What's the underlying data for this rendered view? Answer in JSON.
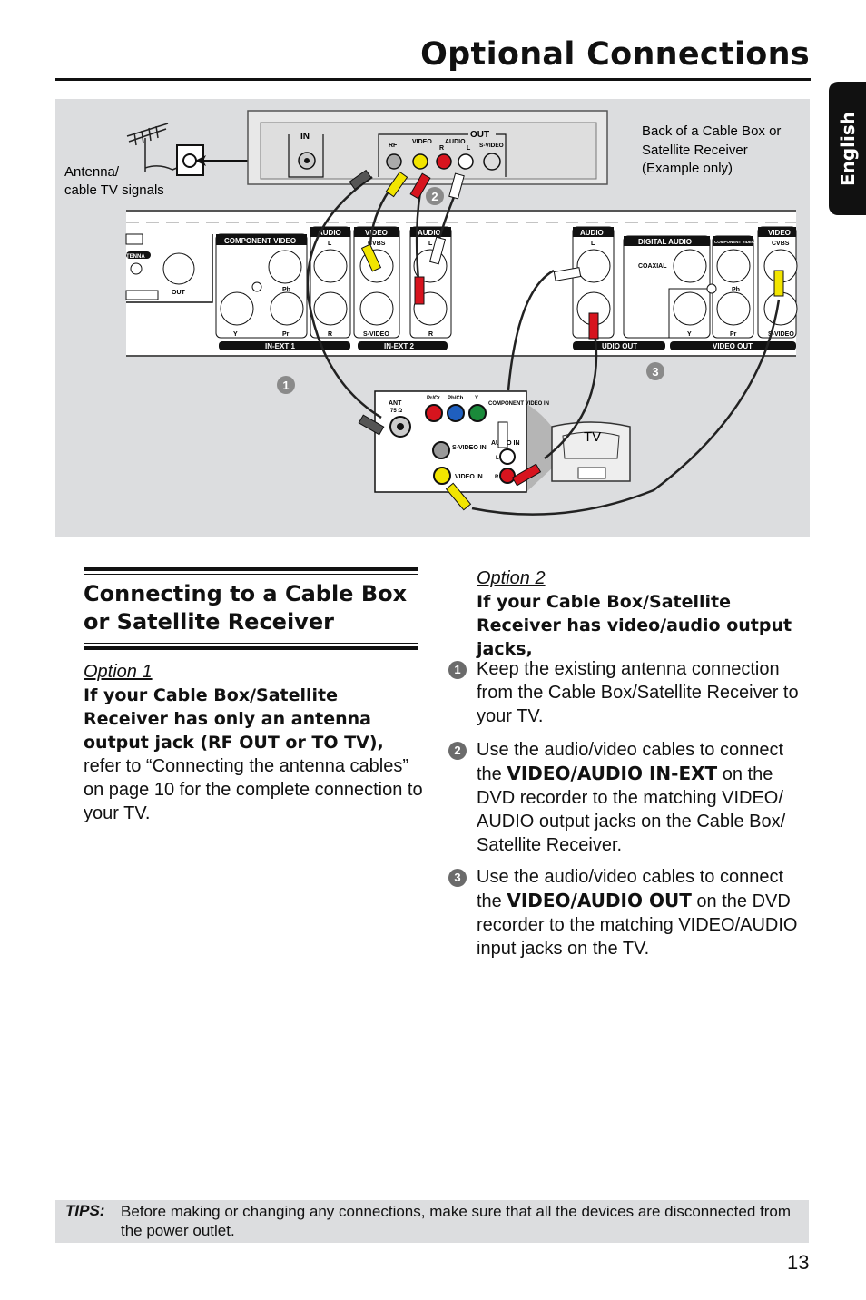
{
  "header": {
    "title": "Optional Connections",
    "language_tab": "English"
  },
  "diagram": {
    "antenna_label": [
      "Antenna/",
      "cable TV signals"
    ],
    "cablebox_caption": [
      "Back of a Cable Box or",
      "Satellite Receiver",
      "(Example only)"
    ],
    "cablebox": {
      "in": "IN",
      "out": "OUT",
      "rf": "RF",
      "video": "VIDEO",
      "audio": "AUDIO",
      "r": "R",
      "l": "L",
      "svideo": "S-VIDEO"
    },
    "recorder": {
      "component_video": "COMPONENT VIDEO",
      "audio": "AUDIO",
      "video": "VIDEO",
      "cvbs": "CVBS",
      "svideo": "S-VIDEO",
      "l": "L",
      "r": "R",
      "y": "Y",
      "pb": "Pb",
      "pr": "Pr",
      "antenna": "TENNA",
      "out": "OUT",
      "in_ext1": "IN-EXT 1",
      "in_ext2": "IN-EXT 2",
      "digital_audio": "DIGITAL AUDIO",
      "coaxial": "COAXIAL",
      "component_video_small": "COMPONENT VIDEO",
      "audio_out": "UDIO OUT",
      "video_out": "VIDEO OUT"
    },
    "tv_panel": {
      "ant": "ANT",
      "ant_ohm": "75 Ω",
      "prcr": "Pr/Cr",
      "pbcb": "Pb/Cb",
      "y": "Y",
      "component_in": "COMPONENT VIDEO IN",
      "svideo_in": "S-VIDEO IN",
      "video_in": "VIDEO IN",
      "audio_in": "AUDIO IN",
      "l": "L",
      "r": "R"
    },
    "tv_label": "TV",
    "markers": [
      "1",
      "2",
      "3"
    ],
    "colors": {
      "yellow": "#f2e500",
      "red": "#d7141e",
      "white": "#ffffff",
      "blue": "#1f5fbf",
      "green": "#1a8a3a",
      "background": "#dcdddf"
    }
  },
  "left": {
    "heading": "Connecting to a Cable Box or Satellite Receiver",
    "option_label": "Option 1",
    "condition": "If your Cable Box/Satellite Receiver has only an antenna output jack (RF OUT or TO TV),",
    "text": "refer to “Connecting the antenna cables” on page 10 for the complete connection to your TV."
  },
  "right": {
    "option_label": "Option 2",
    "condition": "If your Cable Box/Satellite Receiver has video/audio output jacks,",
    "steps": [
      {
        "num": "1",
        "text": "Keep the existing antenna connection from the Cable Box/Satellite Receiver to your TV."
      },
      {
        "num": "2",
        "pre": "Use the audio/video cables to connect the ",
        "bold": "VIDEO/AUDIO IN-EXT",
        "post": " on the DVD recorder to the matching VIDEO/ AUDIO output jacks on the Cable Box/ Satellite Receiver."
      },
      {
        "num": "3",
        "pre": "Use the audio/video cables to connect the ",
        "bold": "VIDEO/AUDIO OUT",
        "post": " on the DVD recorder to the matching VIDEO/AUDIO input jacks on the TV."
      }
    ]
  },
  "tips": {
    "label": "TIPS:",
    "text": "Before making or changing any connections, make sure that all the devices are disconnected from the power outlet."
  },
  "page_number": "13"
}
